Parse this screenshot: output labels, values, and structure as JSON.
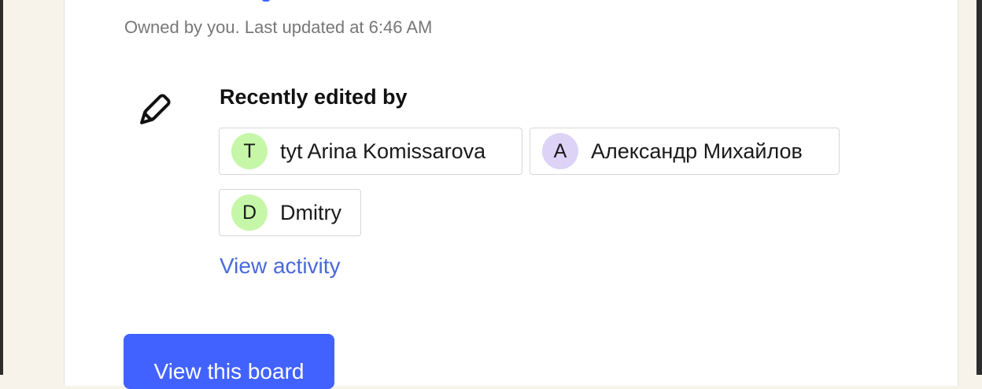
{
  "header": {
    "subtitle": "Owned by you. Last updated at 6:46 AM"
  },
  "recently_edited": {
    "heading": "Recently edited by",
    "icon": "pencil-icon",
    "editors": [
      {
        "initial": "T",
        "name": "tyt Arina Komissarova",
        "avatar_color": "#c6f7a8"
      },
      {
        "initial": "A",
        "name": "Александр Михайлов",
        "avatar_color": "#dcd3f7"
      },
      {
        "initial": "D",
        "name": "Dmitry",
        "avatar_color": "#c6f7a8"
      }
    ],
    "view_activity_label": "View activity"
  },
  "actions": {
    "primary_label": "View this board",
    "primary_color": "#4262ff",
    "link_color": "#4a6ad9"
  }
}
